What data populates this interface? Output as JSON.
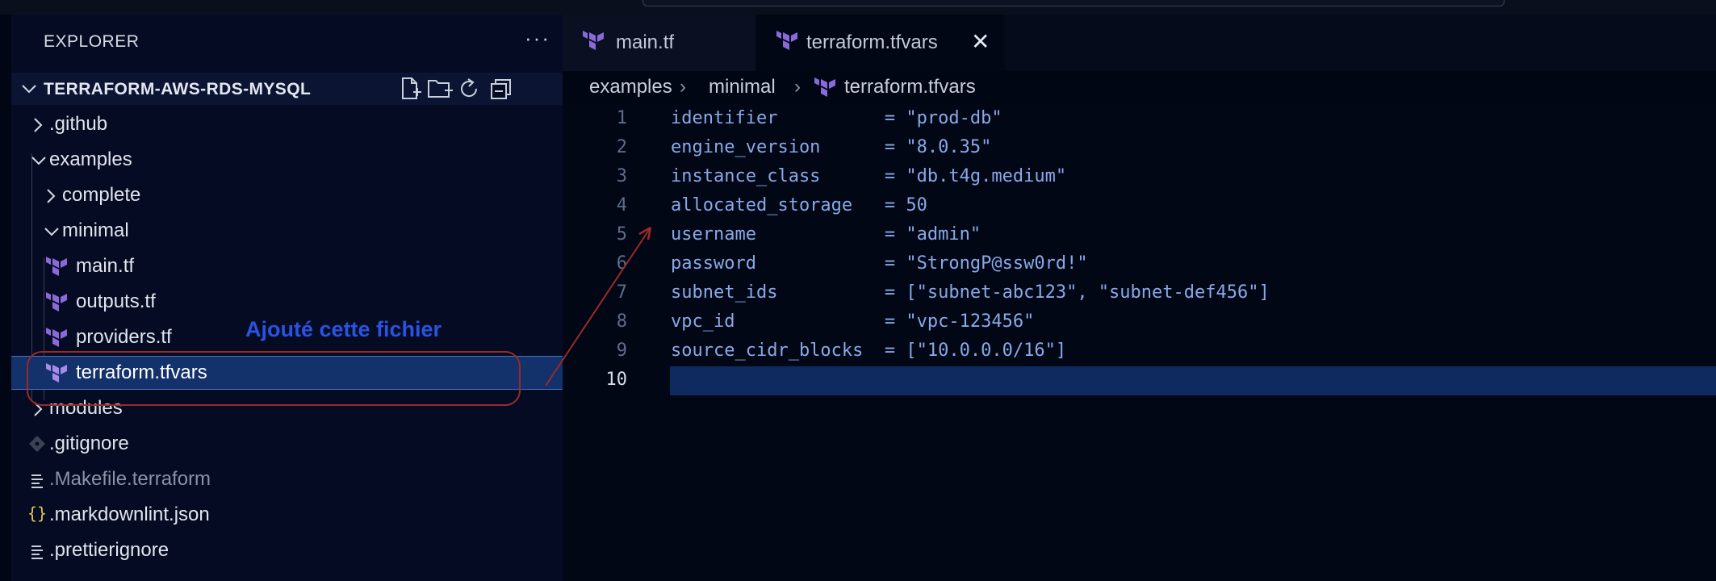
{
  "explorer": {
    "title": "EXPLORER",
    "more_label": "···",
    "root_label": "TERRAFORM-AWS-RDS-MYSQL",
    "actions": [
      "new-file-icon",
      "new-folder-icon",
      "refresh-icon",
      "collapse-all-icon"
    ],
    "items": [
      {
        "label": ".github",
        "type": "folder",
        "expanded": false
      },
      {
        "label": "examples",
        "type": "folder",
        "expanded": true
      },
      {
        "label": "complete",
        "type": "folder",
        "expanded": false
      },
      {
        "label": "minimal",
        "type": "folder",
        "expanded": true
      },
      {
        "label": "main.tf",
        "type": "terraform"
      },
      {
        "label": "outputs.tf",
        "type": "terraform"
      },
      {
        "label": "providers.tf",
        "type": "terraform"
      },
      {
        "label": "terraform.tfvars",
        "type": "terraform",
        "selected": true
      },
      {
        "label": "modules",
        "type": "folder",
        "expanded": false
      },
      {
        "label": ".gitignore",
        "type": "git"
      },
      {
        "label": ".Makefile.terraform",
        "type": "text"
      },
      {
        "label": ".markdownlint.json",
        "type": "json"
      },
      {
        "label": ".prettierignore",
        "type": "text"
      }
    ]
  },
  "tabs": [
    {
      "label": "main.tf",
      "active": false
    },
    {
      "label": "terraform.tfvars",
      "active": true,
      "close_label": "✕"
    }
  ],
  "breadcrumb": {
    "parts": [
      "examples",
      "minimal",
      "terraform.tfvars"
    ],
    "separator": "›"
  },
  "editor": {
    "current_line": 10,
    "lines": [
      {
        "num": "1",
        "text": "identifier          = \"prod-db\""
      },
      {
        "num": "2",
        "text": "engine_version      = \"8.0.35\""
      },
      {
        "num": "3",
        "text": "instance_class      = \"db.t4g.medium\""
      },
      {
        "num": "4",
        "text": "allocated_storage   = 50"
      },
      {
        "num": "5",
        "text": "username            = \"admin\""
      },
      {
        "num": "6",
        "text": "password            = \"StrongP@ssw0rd!\""
      },
      {
        "num": "7",
        "text": "subnet_ids          = [\"subnet-abc123\", \"subnet-def456\"]"
      },
      {
        "num": "8",
        "text": "vpc_id              = \"vpc-123456\""
      },
      {
        "num": "9",
        "text": "source_cidr_blocks  = [\"10.0.0.0/16\"]"
      },
      {
        "num": "10",
        "text": ""
      }
    ]
  },
  "annotation": {
    "text": "Ajouté cette fichier",
    "color": "#2953e0",
    "mark_color": "#9a2a2a"
  },
  "colors": {
    "terraform_icon": "#8a6ad8",
    "selection": "#13316b",
    "code_text": "#88a9e6"
  }
}
